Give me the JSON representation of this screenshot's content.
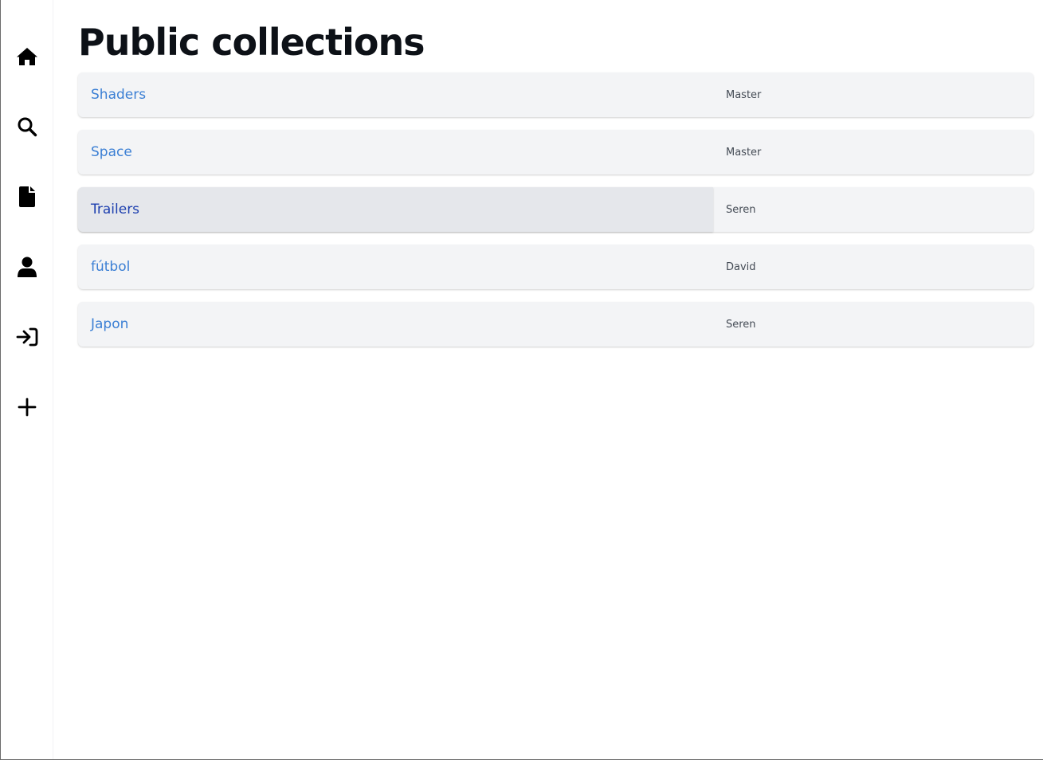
{
  "sidebar": {
    "items": [
      {
        "icon": "home-icon",
        "label": "Home"
      },
      {
        "icon": "search-icon",
        "label": "Search"
      },
      {
        "icon": "file-icon",
        "label": "Files"
      },
      {
        "icon": "user-icon",
        "label": "Profile"
      },
      {
        "icon": "sign-in-icon",
        "label": "Sign in"
      },
      {
        "icon": "plus-icon",
        "label": "New"
      }
    ]
  },
  "page": {
    "title": "Public collections"
  },
  "collections": [
    {
      "name": "Shaders",
      "owner": "Master"
    },
    {
      "name": "Space",
      "owner": "Master"
    },
    {
      "name": "Trailers",
      "owner": "Seren"
    },
    {
      "name": "fútbol",
      "owner": "David"
    },
    {
      "name": "Japon",
      "owner": "Seren"
    }
  ],
  "colors": {
    "link": "#3b7fd4",
    "link_hover": "#1e40af",
    "row_bg": "#f3f4f6",
    "row_hover_bg": "#e5e7eb",
    "title": "#0d1117"
  }
}
